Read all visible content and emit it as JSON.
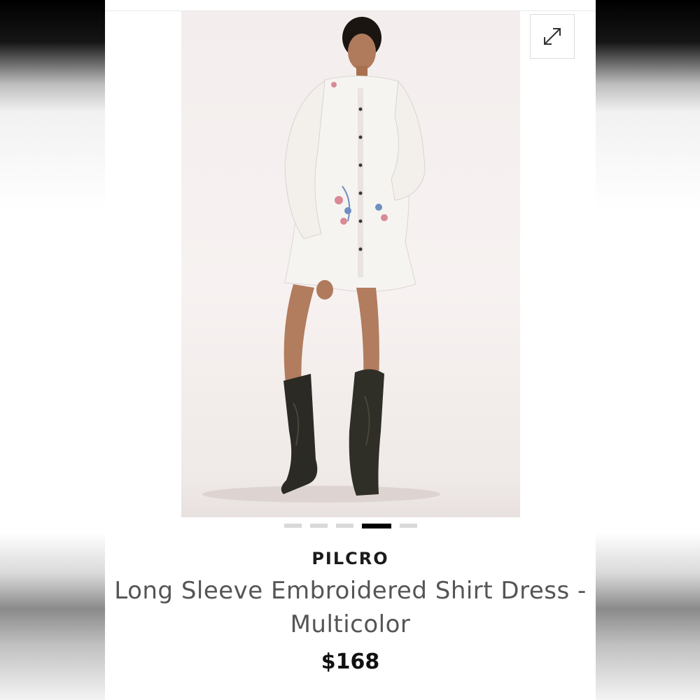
{
  "product": {
    "brand": "PILCRO",
    "title": "Long Sleeve Embroidered Shirt Dress - Multicolor",
    "price": "$168"
  },
  "gallery": {
    "image_count": 5,
    "active_index": 3,
    "expand_icon": "expand-arrows-icon",
    "photo_subject": "model in white embroidered shirt dress and dark cowboy boots"
  },
  "colors": {
    "active_dot": "#000000",
    "inactive_dot": "#d9d9d9",
    "title_text": "#555555",
    "brand_text": "#1b1b1b"
  }
}
